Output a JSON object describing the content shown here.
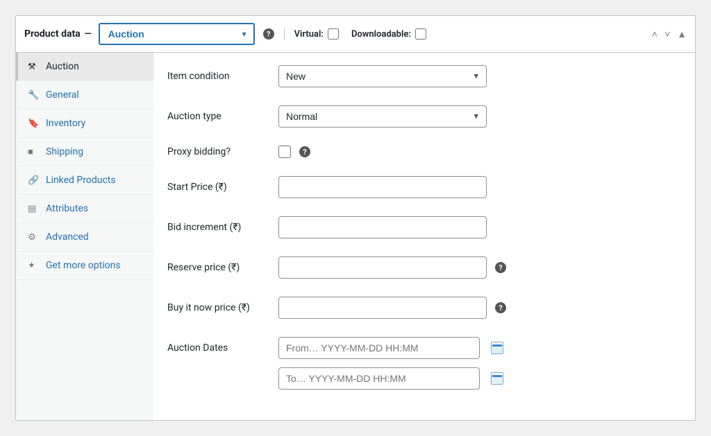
{
  "header": {
    "title": "Product data",
    "dash": "—",
    "product_type": "Auction",
    "virtual_label": "Virtual:",
    "downloadable_label": "Downloadable:",
    "virtual_checked": false,
    "downloadable_checked": false
  },
  "tabs": {
    "items": [
      {
        "icon": "gavel-icon",
        "label": "Auction",
        "name": "tab-auction",
        "active": true
      },
      {
        "icon": "wrench-icon",
        "label": "General",
        "name": "tab-general",
        "active": false
      },
      {
        "icon": "tag-icon",
        "label": "Inventory",
        "name": "tab-inventory",
        "active": false
      },
      {
        "icon": "truck-icon",
        "label": "Shipping",
        "name": "tab-shipping",
        "active": false
      },
      {
        "icon": "link-icon",
        "label": "Linked Products",
        "name": "tab-linked-products",
        "active": false
      },
      {
        "icon": "list-icon",
        "label": "Attributes",
        "name": "tab-attributes",
        "active": false
      },
      {
        "icon": "gear-icon",
        "label": "Advanced",
        "name": "tab-advanced",
        "active": false
      },
      {
        "icon": "sparkle-icon",
        "label": "Get more options",
        "name": "tab-get-more-options",
        "active": false
      }
    ]
  },
  "icons": {
    "gavel-icon": "⚒",
    "wrench-icon": "🔧",
    "tag-icon": "🔖",
    "truck-icon": "■",
    "link-icon": "🔗",
    "list-icon": "▤",
    "gear-icon": "⚙",
    "sparkle-icon": "✦",
    "help-icon": "?",
    "chevron-up-icon": "˄",
    "chevron-down-icon": "˅",
    "triangle-up-icon": "▲"
  },
  "form": {
    "item_condition": {
      "label": "Item condition",
      "value": "New"
    },
    "auction_type": {
      "label": "Auction type",
      "value": "Normal"
    },
    "proxy_bidding": {
      "label": "Proxy bidding?",
      "checked": false
    },
    "start_price": {
      "label": "Start Price (₹)",
      "value": ""
    },
    "bid_increment": {
      "label": "Bid increment (₹)",
      "value": ""
    },
    "reserve_price": {
      "label": "Reserve price (₹)",
      "value": ""
    },
    "buy_now_price": {
      "label": "Buy it now price (₹)",
      "value": ""
    },
    "auction_dates": {
      "label": "Auction Dates",
      "from_placeholder": "From… YYYY-MM-DD HH:MM",
      "to_placeholder": "To… YYYY-MM-DD HH:MM",
      "from_value": "",
      "to_value": ""
    }
  }
}
